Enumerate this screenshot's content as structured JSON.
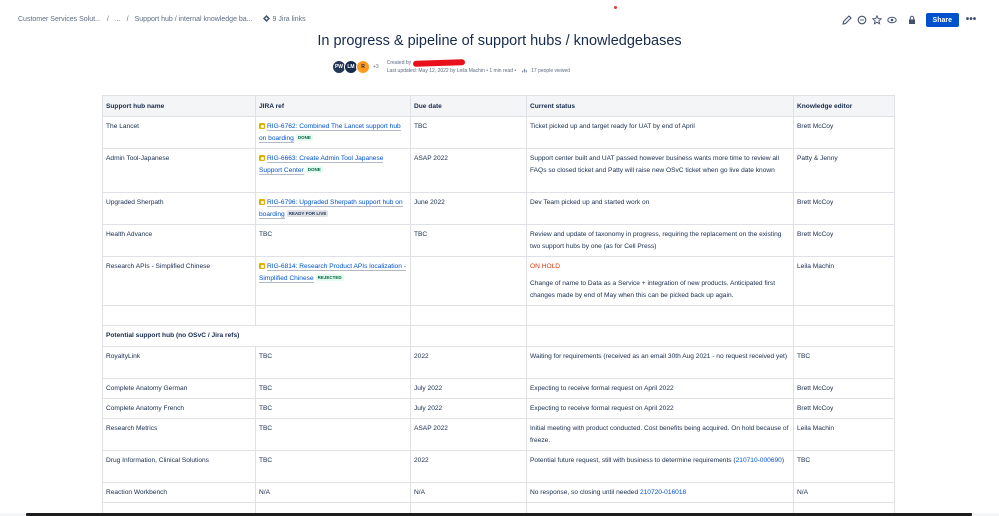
{
  "breadcrumb": {
    "items": [
      "Customer Services Solut...",
      "...",
      "Support hub / internal knowledge ba..."
    ],
    "jira_links": "9 Jira links"
  },
  "toolbar": {
    "share_label": "Share",
    "more_label": "•••",
    "icons": [
      "edit-icon",
      "comment-icon",
      "star-icon",
      "watch-icon",
      "restrictions-icon"
    ]
  },
  "page": {
    "title": "In progress & pipeline of support hubs / knowledgebases",
    "avatars": [
      "PW",
      "LM",
      "R"
    ],
    "avatars_more": "+3",
    "created_by_label": "Created by",
    "last_updated": "Last updated: May 12, 2022 by Leila Machin",
    "read_time": "1 min read",
    "views": "17 people viewed"
  },
  "table": {
    "headers": [
      "Support hub name",
      "JIRA ref",
      "Due date",
      "Current status",
      "Knowledge editor"
    ],
    "rows": [
      {
        "name": "The Lancet",
        "jira": "RIG-6762: Combined The Lancet support hub on boarding",
        "jira_status": "DONE",
        "due": "TBC",
        "status": "Ticket picked up and target ready for UAT by end of April",
        "editor": "Brett McCoy"
      },
      {
        "name": "Admin Tool-Japanese",
        "jira": "RIG-6663: Create Admin Tool Japanese Support Center",
        "jira_status": "DONE",
        "due": "ASAP 2022",
        "status": "Support center built and UAT passed however business wants more time to review all FAQs so closed ticket and Patty will raise new OSvC ticket when go live date known",
        "editor": "Patty & Jenny"
      },
      {
        "name": "Upgraded Sherpath",
        "jira": "RIG-6796: Upgraded Sherpath support hub on boarding",
        "jira_status": "READY FOR LIVE",
        "due": "June 2022",
        "status": "Dev Team picked up and started work on",
        "editor": "Brett McCoy"
      },
      {
        "name": "Health Advance",
        "jira": "TBC",
        "due": "TBC",
        "status": "Review and update of taxonomy in progress, requiring the replacement on the existing two support hubs by one (as for Cell Press)",
        "editor": "Brett McCoy"
      },
      {
        "name": "Research APIs - Simplified Chinese",
        "jira": "RIG-6814: Research Product APIs localization - Simplified Chinese",
        "jira_status": "REJECTED",
        "due": "",
        "status_hold": "ON HOLD",
        "status": "Change of name to Data as a Service + integration of new products. Anticipated first changes made by end of May when this can be picked back up again.",
        "editor": "Leila Machin"
      }
    ],
    "section_label": "Potential support hub (no OSvC / Jira refs)",
    "rows2": [
      {
        "name": "RoyaltyLink",
        "jira": "TBC",
        "due": "2022",
        "status": "Waiting for requirements (received as an email 30th Aug 2021 - no request received yet)",
        "editor": "TBC"
      },
      {
        "name": "Complete Anatomy German",
        "jira": "TBC",
        "due": "July 2022",
        "status": "Expecting to receive formal request on April 2022",
        "editor": "Brett McCoy"
      },
      {
        "name": "Complete Anatomy French",
        "jira": "TBC",
        "due": "July 2022",
        "status": "Expecting to receive formal request on April 2022",
        "editor": "Brett McCoy"
      },
      {
        "name": "Research Metrics",
        "jira": "TBC",
        "due": "ASAP 2022",
        "status": "Initial meeting with product conducted. Cost benefits being acquired. On hold because of freeze.",
        "editor": "Leila Machin"
      },
      {
        "name": "Drug Information, Clinical Solutions",
        "jira": "TBC",
        "due": "2022",
        "status_pre": "Potential future request, still with business to determine requirements (",
        "status_link": "210710-000690",
        "status_post": ")",
        "editor": "TBC"
      },
      {
        "name": "Reaction Workbench",
        "jira": "N/A",
        "due": "N/A",
        "status_pre": "No response, so closing until needed ",
        "status_link": "210720-016018",
        "editor": "N/A"
      }
    ]
  },
  "colors": {
    "accent": "#0052cc",
    "on_hold": "#de350b",
    "header_bg": "#f4f5f7"
  }
}
